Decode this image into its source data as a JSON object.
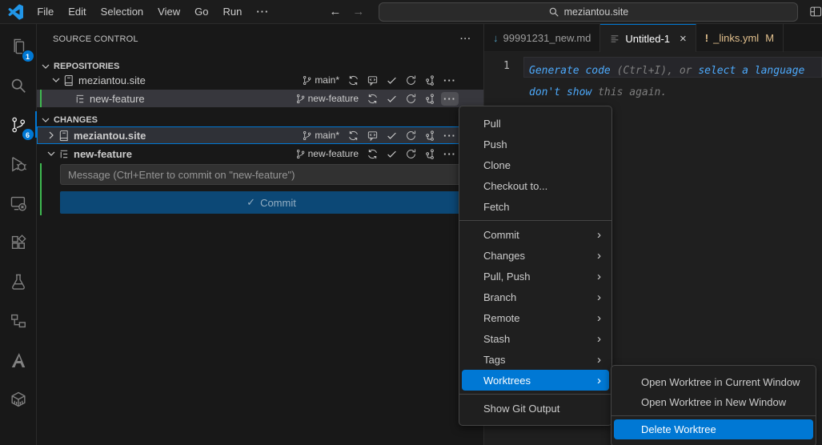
{
  "titlebar": {
    "menus": [
      "File",
      "Edit",
      "Selection",
      "View",
      "Go",
      "Run"
    ],
    "overflow": "···",
    "search_value": "meziantou.site"
  },
  "icons": {
    "back": "←",
    "forward": "→",
    "close": "×",
    "check": "✓",
    "more": "···",
    "submenu_chevron": "›",
    "markdown": "↓",
    "yaml": "!"
  },
  "activity_bar": {
    "explorer_badge": "1",
    "scm_badge": "6"
  },
  "source_control": {
    "title": "SOURCE CONTROL",
    "repositories": {
      "header": "REPOSITORIES",
      "repo_label": "meziantou.site",
      "repo_branch": "main*",
      "worktree_label": "new-feature",
      "worktree_branch": "new-feature"
    },
    "changes": {
      "header": "CHANGES",
      "repo_label": "meziantou.site",
      "repo_branch": "main*",
      "worktree_label": "new-feature",
      "worktree_branch": "new-feature",
      "message_placeholder": "Message (Ctrl+Enter to commit on \"new-feature\")",
      "commit_label": "Commit"
    }
  },
  "editor": {
    "tabs": [
      {
        "label": "99991231_new.md"
      },
      {
        "label": "Untitled-1"
      },
      {
        "label": "_links.yml",
        "badge": "M"
      }
    ],
    "line_number": "1",
    "hint": {
      "link1": "Generate code",
      "text1": " (Ctrl+I), or ",
      "link2": "select a language",
      "link3": "don't show",
      "text2": " this again."
    }
  },
  "context_menu": {
    "group1": [
      "Pull",
      "Push",
      "Clone",
      "Checkout to...",
      "Fetch"
    ],
    "group2": [
      "Commit",
      "Changes",
      "Pull, Push",
      "Branch",
      "Remote",
      "Stash",
      "Tags",
      "Worktrees"
    ],
    "group3": [
      "Show Git Output"
    ],
    "selected_item": "Worktrees"
  },
  "worktree_submenu": {
    "items": [
      "Open Worktree in Current Window",
      "Open Worktree in New Window",
      "Delete Worktree"
    ],
    "selected_item": "Delete Worktree"
  },
  "colors": {
    "accent": "#0078d4",
    "badge": "#0078d4",
    "git_modified": "#e2c08d",
    "worktree_indicator": "#3fb950",
    "editor_link": "#4daafc"
  }
}
